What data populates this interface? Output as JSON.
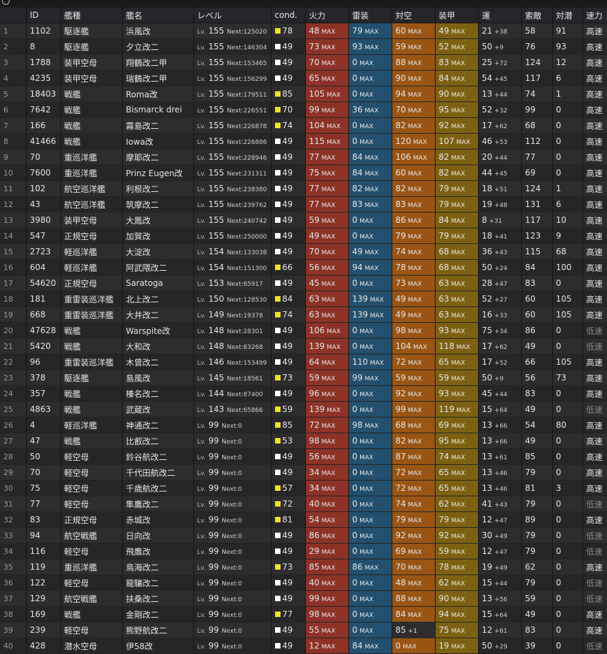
{
  "columns": [
    "",
    "ID",
    "艦種",
    "艦名",
    "レベル",
    "cond.",
    "火力",
    "雷装",
    "対空",
    "装甲",
    "運",
    "索敵",
    "対潜",
    "速力"
  ],
  "lv_prefix": "Lv.",
  "next_prefix": "Next:",
  "max_label": "MAX",
  "colors": {
    "fire": "#8d3226",
    "torpedo": "#22506e",
    "aa": "#9a5514",
    "armor": "#7d6112",
    "cond_high": "#f2e227",
    "cond_normal": "#ffffff"
  },
  "rows": [
    {
      "no": "1",
      "id": "1102",
      "type": "駆逐艦",
      "name": "浜風改",
      "lv": "155",
      "next": "125020",
      "cond": "78",
      "cond_high": true,
      "fp": "48",
      "tp": "79",
      "aa": "60",
      "ar": "49",
      "luck": "21",
      "luck_inc": "+38",
      "los": "58",
      "asw": "91",
      "speed": "高速"
    },
    {
      "no": "2",
      "id": "8",
      "type": "駆逐艦",
      "name": "夕立改二",
      "lv": "155",
      "next": "146304",
      "cond": "49",
      "cond_high": false,
      "fp": "73",
      "tp": "93",
      "aa": "59",
      "ar": "52",
      "luck": "50",
      "luck_inc": "+9",
      "los": "76",
      "asw": "93",
      "speed": "高速"
    },
    {
      "no": "3",
      "id": "1788",
      "type": "装甲空母",
      "name": "翔鶴改二甲",
      "lv": "155",
      "next": "153465",
      "cond": "49",
      "cond_high": false,
      "fp": "70",
      "tp": "0",
      "aa": "88",
      "ar": "83",
      "luck": "25",
      "luck_inc": "+72",
      "los": "124",
      "asw": "12",
      "speed": "高速"
    },
    {
      "no": "4",
      "id": "4235",
      "type": "装甲空母",
      "name": "瑞鶴改二甲",
      "lv": "155",
      "next": "156299",
      "cond": "49",
      "cond_high": false,
      "fp": "65",
      "tp": "0",
      "aa": "90",
      "ar": "84",
      "luck": "54",
      "luck_inc": "+45",
      "los": "117",
      "asw": "6",
      "speed": "高速"
    },
    {
      "no": "5",
      "id": "18403",
      "type": "戦艦",
      "name": "Roma改",
      "lv": "155",
      "next": "179511",
      "cond": "85",
      "cond_high": true,
      "fp": "105",
      "tp": "0",
      "aa": "94",
      "ar": "90",
      "luck": "13",
      "luck_inc": "+44",
      "los": "74",
      "asw": "1",
      "speed": "高速"
    },
    {
      "no": "6",
      "id": "7642",
      "type": "戦艦",
      "name": "Bismarck drei",
      "lv": "155",
      "next": "226551",
      "cond": "70",
      "cond_high": true,
      "fp": "99",
      "tp": "36",
      "aa": "70",
      "ar": "95",
      "luck": "52",
      "luck_inc": "+32",
      "los": "99",
      "asw": "0",
      "speed": "高速"
    },
    {
      "no": "7",
      "id": "166",
      "type": "戦艦",
      "name": "霧島改二",
      "lv": "155",
      "next": "226878",
      "cond": "74",
      "cond_high": true,
      "fp": "104",
      "tp": "0",
      "aa": "82",
      "ar": "92",
      "luck": "17",
      "luck_inc": "+62",
      "los": "68",
      "asw": "0",
      "speed": "高速"
    },
    {
      "no": "8",
      "id": "41466",
      "type": "戦艦",
      "name": "Iowa改",
      "lv": "155",
      "next": "226886",
      "cond": "49",
      "cond_high": false,
      "fp": "115",
      "tp": "0",
      "aa": "120",
      "ar": "107",
      "luck": "46",
      "luck_inc": "+53",
      "los": "112",
      "asw": "0",
      "speed": "高速"
    },
    {
      "no": "9",
      "id": "70",
      "type": "重巡洋艦",
      "name": "摩耶改二",
      "lv": "155",
      "next": "228946",
      "cond": "49",
      "cond_high": false,
      "fp": "77",
      "tp": "84",
      "aa": "106",
      "ar": "82",
      "luck": "20",
      "luck_inc": "+44",
      "los": "77",
      "asw": "0",
      "speed": "高速"
    },
    {
      "no": "10",
      "id": "7600",
      "type": "重巡洋艦",
      "name": "Prinz Eugen改",
      "lv": "155",
      "next": "231311",
      "cond": "49",
      "cond_high": false,
      "fp": "75",
      "tp": "84",
      "aa": "60",
      "ar": "82",
      "luck": "44",
      "luck_inc": "+45",
      "los": "69",
      "asw": "0",
      "speed": "高速"
    },
    {
      "no": "11",
      "id": "102",
      "type": "航空巡洋艦",
      "name": "利根改二",
      "lv": "155",
      "next": "238380",
      "cond": "49",
      "cond_high": false,
      "fp": "77",
      "tp": "82",
      "aa": "82",
      "ar": "79",
      "luck": "18",
      "luck_inc": "+51",
      "los": "124",
      "asw": "1",
      "speed": "高速"
    },
    {
      "no": "12",
      "id": "43",
      "type": "航空巡洋艦",
      "name": "筑摩改二",
      "lv": "155",
      "next": "239762",
      "cond": "49",
      "cond_high": false,
      "fp": "77",
      "tp": "83",
      "aa": "83",
      "ar": "79",
      "luck": "19",
      "luck_inc": "+48",
      "los": "131",
      "asw": "6",
      "speed": "高速"
    },
    {
      "no": "13",
      "id": "3980",
      "type": "装甲空母",
      "name": "大鳳改",
      "lv": "155",
      "next": "240742",
      "cond": "49",
      "cond_high": false,
      "fp": "59",
      "tp": "0",
      "aa": "86",
      "ar": "84",
      "luck": "8",
      "luck_inc": "+31",
      "los": "117",
      "asw": "10",
      "speed": "高速"
    },
    {
      "no": "14",
      "id": "547",
      "type": "正規空母",
      "name": "加賀改",
      "lv": "155",
      "next": "250000",
      "cond": "49",
      "cond_high": false,
      "fp": "49",
      "tp": "0",
      "aa": "79",
      "ar": "79",
      "luck": "18",
      "luck_inc": "+41",
      "los": "123",
      "asw": "9",
      "speed": "高速"
    },
    {
      "no": "15",
      "id": "2723",
      "type": "軽巡洋艦",
      "name": "大淀改",
      "lv": "154",
      "next": "133038",
      "cond": "49",
      "cond_high": false,
      "fp": "70",
      "tp": "49",
      "aa": "74",
      "ar": "68",
      "luck": "36",
      "luck_inc": "+43",
      "los": "115",
      "asw": "68",
      "speed": "高速"
    },
    {
      "no": "16",
      "id": "604",
      "type": "軽巡洋艦",
      "name": "阿武隈改二",
      "lv": "154",
      "next": "151300",
      "cond": "66",
      "cond_high": true,
      "fp": "56",
      "tp": "94",
      "aa": "78",
      "ar": "68",
      "luck": "50",
      "luck_inc": "+24",
      "los": "84",
      "asw": "100",
      "speed": "高速"
    },
    {
      "no": "17",
      "id": "54620",
      "type": "正規空母",
      "name": "Saratoga",
      "lv": "153",
      "next": "65917",
      "cond": "49",
      "cond_high": false,
      "fp": "45",
      "tp": "0",
      "aa": "73",
      "ar": "63",
      "luck": "28",
      "luck_inc": "+47",
      "los": "83",
      "asw": "0",
      "speed": "高速"
    },
    {
      "no": "18",
      "id": "181",
      "type": "重雷装巡洋艦",
      "name": "北上改二",
      "lv": "150",
      "next": "128530",
      "cond": "84",
      "cond_high": true,
      "fp": "63",
      "tp": "139",
      "aa": "49",
      "ar": "63",
      "luck": "52",
      "luck_inc": "+27",
      "los": "60",
      "asw": "105",
      "speed": "高速"
    },
    {
      "no": "19",
      "id": "668",
      "type": "重雷装巡洋艦",
      "name": "大井改二",
      "lv": "149",
      "next": "19378",
      "cond": "74",
      "cond_high": true,
      "fp": "63",
      "tp": "139",
      "aa": "49",
      "ar": "63",
      "luck": "16",
      "luck_inc": "+33",
      "los": "60",
      "asw": "105",
      "speed": "高速"
    },
    {
      "no": "20",
      "id": "47628",
      "type": "戦艦",
      "name": "Warspite改",
      "lv": "148",
      "next": "28301",
      "cond": "49",
      "cond_high": false,
      "fp": "106",
      "tp": "0",
      "aa": "98",
      "ar": "93",
      "luck": "75",
      "luck_inc": "+34",
      "los": "86",
      "asw": "0",
      "speed": "低速"
    },
    {
      "no": "21",
      "id": "5420",
      "type": "戦艦",
      "name": "大和改",
      "lv": "148",
      "next": "83268",
      "cond": "49",
      "cond_high": false,
      "fp": "139",
      "tp": "0",
      "aa": "104",
      "ar": "118",
      "luck": "17",
      "luck_inc": "+62",
      "los": "49",
      "asw": "0",
      "speed": "低速"
    },
    {
      "no": "22",
      "id": "96",
      "type": "重雷装巡洋艦",
      "name": "木曾改二",
      "lv": "146",
      "next": "153499",
      "cond": "49",
      "cond_high": false,
      "fp": "64",
      "tp": "110",
      "aa": "72",
      "ar": "65",
      "luck": "17",
      "luck_inc": "+52",
      "los": "66",
      "asw": "105",
      "speed": "高速"
    },
    {
      "no": "23",
      "id": "378",
      "type": "駆逐艦",
      "name": "島風改",
      "lv": "145",
      "next": "18561",
      "cond": "73",
      "cond_high": true,
      "fp": "59",
      "tp": "99",
      "aa": "59",
      "ar": "59",
      "luck": "50",
      "luck_inc": "+9",
      "los": "56",
      "asw": "73",
      "speed": "高速"
    },
    {
      "no": "24",
      "id": "357",
      "type": "戦艦",
      "name": "榛名改二",
      "lv": "144",
      "next": "87400",
      "cond": "49",
      "cond_high": false,
      "fp": "96",
      "tp": "0",
      "aa": "92",
      "ar": "93",
      "luck": "45",
      "luck_inc": "+44",
      "los": "83",
      "asw": "0",
      "speed": "高速"
    },
    {
      "no": "25",
      "id": "4863",
      "type": "戦艦",
      "name": "武蔵改",
      "lv": "143",
      "next": "65866",
      "cond": "59",
      "cond_high": true,
      "fp": "139",
      "tp": "0",
      "aa": "99",
      "ar": "119",
      "luck": "15",
      "luck_inc": "+64",
      "los": "49",
      "asw": "0",
      "speed": "低速"
    },
    {
      "no": "26",
      "id": "4",
      "type": "軽巡洋艦",
      "name": "神通改二",
      "lv": "99",
      "next": "0",
      "cond": "85",
      "cond_high": true,
      "fp": "72",
      "tp": "98",
      "aa": "68",
      "ar": "69",
      "luck": "13",
      "luck_inc": "+66",
      "los": "54",
      "asw": "80",
      "speed": "高速"
    },
    {
      "no": "27",
      "id": "47",
      "type": "戦艦",
      "name": "比叡改二",
      "lv": "99",
      "next": "0",
      "cond": "53",
      "cond_high": true,
      "fp": "98",
      "tp": "0",
      "aa": "82",
      "ar": "95",
      "luck": "13",
      "luck_inc": "+66",
      "los": "49",
      "asw": "0",
      "speed": "高速"
    },
    {
      "no": "28",
      "id": "50",
      "type": "軽空母",
      "name": "鈴谷航改二",
      "lv": "99",
      "next": "0",
      "cond": "49",
      "cond_high": false,
      "fp": "56",
      "tp": "0",
      "aa": "87",
      "ar": "74",
      "luck": "13",
      "luck_inc": "+61",
      "los": "85",
      "asw": "0",
      "speed": "高速"
    },
    {
      "no": "29",
      "id": "70",
      "type": "軽空母",
      "name": "千代田航改二",
      "lv": "99",
      "next": "0",
      "cond": "49",
      "cond_high": false,
      "fp": "34",
      "tp": "0",
      "aa": "72",
      "ar": "65",
      "luck": "13",
      "luck_inc": "+46",
      "los": "79",
      "asw": "0",
      "speed": "高速"
    },
    {
      "no": "30",
      "id": "75",
      "type": "軽空母",
      "name": "千歳航改二",
      "lv": "99",
      "next": "0",
      "cond": "57",
      "cond_high": true,
      "fp": "34",
      "tp": "0",
      "aa": "72",
      "ar": "65",
      "luck": "13",
      "luck_inc": "+46",
      "los": "81",
      "asw": "3",
      "speed": "高速"
    },
    {
      "no": "31",
      "id": "77",
      "type": "軽空母",
      "name": "隼鷹改二",
      "lv": "99",
      "next": "0",
      "cond": "72",
      "cond_high": true,
      "fp": "40",
      "tp": "0",
      "aa": "74",
      "ar": "62",
      "luck": "41",
      "luck_inc": "+43",
      "los": "79",
      "asw": "0",
      "speed": "低速"
    },
    {
      "no": "32",
      "id": "83",
      "type": "正規空母",
      "name": "赤城改",
      "lv": "99",
      "next": "0",
      "cond": "81",
      "cond_high": true,
      "fp": "54",
      "tp": "0",
      "aa": "79",
      "ar": "79",
      "luck": "12",
      "luck_inc": "+47",
      "los": "89",
      "asw": "0",
      "speed": "高速"
    },
    {
      "no": "33",
      "id": "94",
      "type": "航空戦艦",
      "name": "日向改",
      "lv": "99",
      "next": "0",
      "cond": "49",
      "cond_high": false,
      "fp": "86",
      "tp": "0",
      "aa": "92",
      "ar": "92",
      "luck": "30",
      "luck_inc": "+49",
      "los": "79",
      "asw": "0",
      "speed": "低速"
    },
    {
      "no": "34",
      "id": "116",
      "type": "軽空母",
      "name": "飛鷹改",
      "lv": "99",
      "next": "0",
      "cond": "49",
      "cond_high": false,
      "fp": "29",
      "tp": "0",
      "aa": "69",
      "ar": "59",
      "luck": "12",
      "luck_inc": "+47",
      "los": "79",
      "asw": "0",
      "speed": "低速"
    },
    {
      "no": "35",
      "id": "119",
      "type": "重巡洋艦",
      "name": "鳥海改二",
      "lv": "99",
      "next": "0",
      "cond": "73",
      "cond_high": true,
      "fp": "85",
      "tp": "86",
      "aa": "70",
      "ar": "78",
      "luck": "19",
      "luck_inc": "+49",
      "los": "62",
      "asw": "0",
      "speed": "高速"
    },
    {
      "no": "36",
      "id": "122",
      "type": "軽空母",
      "name": "龍驤改二",
      "lv": "99",
      "next": "0",
      "cond": "49",
      "cond_high": false,
      "fp": "40",
      "tp": "0",
      "aa": "48",
      "ar": "62",
      "luck": "15",
      "luck_inc": "+44",
      "los": "79",
      "asw": "0",
      "speed": "低速"
    },
    {
      "no": "37",
      "id": "129",
      "type": "航空戦艦",
      "name": "扶桑改二",
      "lv": "99",
      "next": "0",
      "cond": "49",
      "cond_high": false,
      "fp": "99",
      "tp": "0",
      "aa": "88",
      "ar": "90",
      "luck": "13",
      "luck_inc": "+56",
      "los": "59",
      "asw": "0",
      "speed": "低速"
    },
    {
      "no": "38",
      "id": "169",
      "type": "戦艦",
      "name": "金剛改二",
      "lv": "99",
      "next": "0",
      "cond": "77",
      "cond_high": true,
      "fp": "98",
      "tp": "0",
      "aa": "84",
      "ar": "94",
      "luck": "15",
      "luck_inc": "+64",
      "los": "49",
      "asw": "0",
      "speed": "高速"
    },
    {
      "no": "39",
      "id": "239",
      "type": "軽空母",
      "name": "熊野航改二",
      "lv": "99",
      "next": "0",
      "cond": "49",
      "cond_high": false,
      "fp": "55",
      "tp": "0",
      "aa": "85",
      "aa_inc": "+1",
      "ar": "75",
      "luck": "12",
      "luck_inc": "+61",
      "los": "83",
      "asw": "0",
      "speed": "高速"
    },
    {
      "no": "40",
      "id": "428",
      "type": "潜水空母",
      "name": "伊58改",
      "lv": "99",
      "next": "0",
      "cond": "49",
      "cond_high": false,
      "fp": "12",
      "tp": "84",
      "aa": "0",
      "ar": "19",
      "luck": "50",
      "luck_inc": "+29",
      "los": "39",
      "asw": "0",
      "speed": "低速"
    }
  ]
}
